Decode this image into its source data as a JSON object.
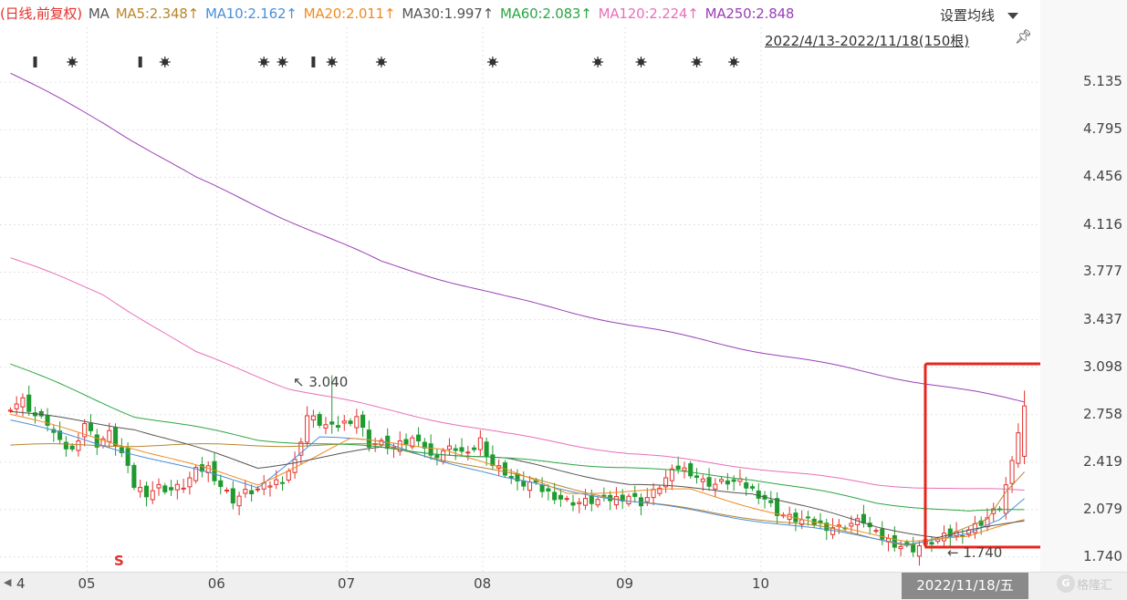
{
  "header": {
    "indicator": "(日线,前复权)",
    "ma_prefix": "MA",
    "ma_items": [
      {
        "label": "MA5:2.348↑",
        "color": "#b8862c"
      },
      {
        "label": "MA10:2.162↑",
        "color": "#4b8fd9"
      },
      {
        "label": "MA20:2.011↑",
        "color": "#f08a1e"
      },
      {
        "label": "MA30:1.997↑",
        "color": "#555555"
      },
      {
        "label": "MA60:2.083↑",
        "color": "#2aa642"
      },
      {
        "label": "MA120:2.224↑",
        "color": "#e86fb8"
      },
      {
        "label": "MA250:2.848",
        "color": "#9a3fb5"
      }
    ],
    "settings_label": "设置均线",
    "range_label": "2022/4/13-2022/11/18(150根)"
  },
  "annotations": {
    "high": "3.040",
    "low": "1.740",
    "s_marker": "S"
  },
  "cursor_date": "2022/11/18/五",
  "logo_text": "格隆汇",
  "colors": {
    "up": "#e3312d",
    "down": "#1f9a2e",
    "highlight_box": "#e8261e"
  },
  "chart_data": {
    "type": "candlestick",
    "x_ticks": [
      "4",
      "05",
      "06",
      "07",
      "08",
      "09",
      "10"
    ],
    "y_ticks": [
      1.74,
      2.079,
      2.419,
      2.758,
      3.098,
      3.437,
      3.777,
      4.116,
      4.456,
      4.795,
      5.135
    ],
    "ylim": [
      1.68,
      5.3
    ],
    "bars": 150,
    "first_date": "2022/4/13",
    "last_date": "2022/11/18",
    "max_price": 3.04,
    "min_price": 1.74,
    "close_key": [
      [
        0,
        2.82
      ],
      [
        2,
        2.86
      ],
      [
        4,
        2.75
      ],
      [
        6,
        2.7
      ],
      [
        8,
        2.55
      ],
      [
        10,
        2.5
      ],
      [
        12,
        2.7
      ],
      [
        14,
        2.55
      ],
      [
        16,
        2.62
      ],
      [
        18,
        2.48
      ],
      [
        20,
        2.25
      ],
      [
        22,
        2.2
      ],
      [
        24,
        2.24
      ],
      [
        26,
        2.22
      ],
      [
        28,
        2.25
      ],
      [
        30,
        2.35
      ],
      [
        32,
        2.38
      ],
      [
        34,
        2.25
      ],
      [
        36,
        2.15
      ],
      [
        38,
        2.2
      ],
      [
        40,
        2.22
      ],
      [
        42,
        2.26
      ],
      [
        44,
        2.3
      ],
      [
        46,
        2.42
      ],
      [
        48,
        2.75
      ],
      [
        50,
        2.7
      ],
      [
        52,
        2.66
      ],
      [
        54,
        2.7
      ],
      [
        56,
        2.75
      ],
      [
        58,
        2.55
      ],
      [
        60,
        2.55
      ],
      [
        62,
        2.52
      ],
      [
        64,
        2.56
      ],
      [
        66,
        2.6
      ],
      [
        68,
        2.45
      ],
      [
        70,
        2.5
      ],
      [
        72,
        2.52
      ],
      [
        74,
        2.46
      ],
      [
        76,
        2.58
      ],
      [
        78,
        2.4
      ],
      [
        80,
        2.35
      ],
      [
        82,
        2.26
      ],
      [
        84,
        2.27
      ],
      [
        86,
        2.22
      ],
      [
        88,
        2.18
      ],
      [
        90,
        2.14
      ],
      [
        92,
        2.13
      ],
      [
        94,
        2.14
      ],
      [
        96,
        2.15
      ],
      [
        98,
        2.16
      ],
      [
        100,
        2.18
      ],
      [
        102,
        2.13
      ],
      [
        104,
        2.2
      ],
      [
        106,
        2.3
      ],
      [
        108,
        2.38
      ],
      [
        110,
        2.35
      ],
      [
        112,
        2.28
      ],
      [
        114,
        2.26
      ],
      [
        116,
        2.28
      ],
      [
        118,
        2.27
      ],
      [
        120,
        2.22
      ],
      [
        122,
        2.16
      ],
      [
        124,
        2.06
      ],
      [
        126,
        2.02
      ],
      [
        128,
        2.0
      ],
      [
        130,
        1.98
      ],
      [
        132,
        1.96
      ],
      [
        134,
        1.95
      ],
      [
        136,
        1.98
      ],
      [
        138,
        2.0
      ],
      [
        140,
        1.9
      ],
      [
        142,
        1.86
      ],
      [
        144,
        1.82
      ],
      [
        146,
        1.8
      ],
      [
        148,
        1.84
      ],
      [
        150,
        1.86
      ],
      [
        152,
        1.9
      ],
      [
        154,
        1.92
      ],
      [
        156,
        1.96
      ],
      [
        158,
        2.02
      ],
      [
        160,
        2.1
      ],
      [
        162,
        2.4
      ],
      [
        164,
        2.88
      ]
    ],
    "ma_series": [
      {
        "name": "MA5",
        "color": "#b8862c",
        "points": [
          [
            60,
            2.54
          ],
          [
            100,
            2.14
          ],
          [
            130,
            1.96
          ],
          [
            145,
            1.83
          ],
          [
            152,
            1.9
          ],
          [
            158,
            2.0
          ],
          [
            161,
            2.2
          ],
          [
            164,
            2.35
          ]
        ]
      },
      {
        "name": "MA10",
        "color": "#4b8fd9",
        "points": [
          [
            0,
            2.72
          ],
          [
            20,
            2.48
          ],
          [
            40,
            2.24
          ],
          [
            50,
            2.6
          ],
          [
            60,
            2.56
          ],
          [
            80,
            2.3
          ],
          [
            100,
            2.14
          ],
          [
            130,
            1.94
          ],
          [
            145,
            1.84
          ],
          [
            155,
            1.9
          ],
          [
            160,
            2.0
          ],
          [
            164,
            2.16
          ]
        ]
      },
      {
        "name": "MA20",
        "color": "#f08a1e",
        "points": [
          [
            0,
            2.76
          ],
          [
            20,
            2.52
          ],
          [
            40,
            2.26
          ],
          [
            55,
            2.58
          ],
          [
            70,
            2.52
          ],
          [
            90,
            2.2
          ],
          [
            110,
            2.22
          ],
          [
            130,
            1.98
          ],
          [
            145,
            1.86
          ],
          [
            155,
            1.88
          ],
          [
            164,
            2.01
          ]
        ]
      },
      {
        "name": "MA30",
        "color": "#555555",
        "points": [
          [
            0,
            2.78
          ],
          [
            20,
            2.66
          ],
          [
            40,
            2.38
          ],
          [
            60,
            2.52
          ],
          [
            80,
            2.44
          ],
          [
            100,
            2.26
          ],
          [
            120,
            2.2
          ],
          [
            140,
            1.96
          ],
          [
            150,
            1.88
          ],
          [
            164,
            2.0
          ]
        ]
      },
      {
        "name": "MA60",
        "color": "#2aa642",
        "points": [
          [
            0,
            3.12
          ],
          [
            20,
            2.75
          ],
          [
            40,
            2.58
          ],
          [
            60,
            2.52
          ],
          [
            80,
            2.44
          ],
          [
            100,
            2.38
          ],
          [
            120,
            2.3
          ],
          [
            140,
            2.13
          ],
          [
            155,
            2.06
          ],
          [
            164,
            2.08
          ]
        ]
      },
      {
        "name": "MA120",
        "color": "#e86fb8",
        "points": [
          [
            0,
            3.88
          ],
          [
            15,
            3.62
          ],
          [
            30,
            3.2
          ],
          [
            45,
            2.95
          ],
          [
            60,
            2.8
          ],
          [
            80,
            2.62
          ],
          [
            100,
            2.48
          ],
          [
            120,
            2.38
          ],
          [
            140,
            2.26
          ],
          [
            155,
            2.22
          ],
          [
            164,
            2.22
          ]
        ]
      },
      {
        "name": "MA250",
        "color": "#9a3fb5",
        "points": [
          [
            0,
            5.2
          ],
          [
            15,
            4.85
          ],
          [
            30,
            4.45
          ],
          [
            45,
            4.15
          ],
          [
            60,
            3.85
          ],
          [
            80,
            3.6
          ],
          [
            100,
            3.4
          ],
          [
            120,
            3.22
          ],
          [
            140,
            3.05
          ],
          [
            164,
            2.85
          ]
        ]
      }
    ],
    "event_markers": [
      {
        "idx": 4,
        "kind": "bar"
      },
      {
        "idx": 10,
        "kind": "star"
      },
      {
        "idx": 21,
        "kind": "bar"
      },
      {
        "idx": 25,
        "kind": "star"
      },
      {
        "idx": 41,
        "kind": "star"
      },
      {
        "idx": 44,
        "kind": "star"
      },
      {
        "idx": 49,
        "kind": "bar"
      },
      {
        "idx": 52,
        "kind": "star"
      },
      {
        "idx": 60,
        "kind": "star"
      },
      {
        "idx": 78,
        "kind": "star"
      },
      {
        "idx": 95,
        "kind": "star"
      },
      {
        "idx": 102,
        "kind": "star"
      },
      {
        "idx": 111,
        "kind": "star"
      },
      {
        "idx": 117,
        "kind": "star"
      }
    ]
  }
}
